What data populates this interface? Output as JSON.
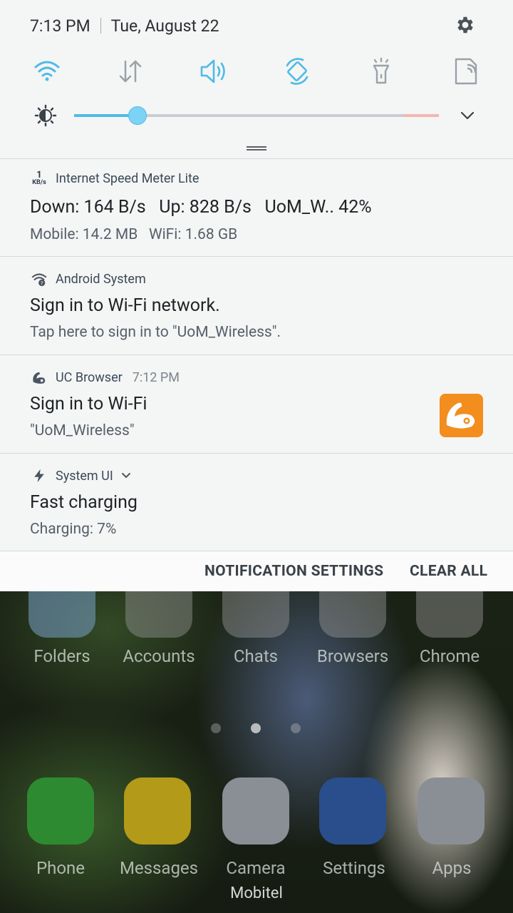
{
  "status_bar": {
    "time": "7:13 PM",
    "date": "Tue, August 22"
  },
  "quick_settings": {
    "toggles": [
      {
        "name": "wifi-icon",
        "active": true
      },
      {
        "name": "data-transfer-icon",
        "active": false
      },
      {
        "name": "sound-icon",
        "active": true
      },
      {
        "name": "auto-rotate-icon",
        "active": true
      },
      {
        "name": "flashlight-icon",
        "active": false
      },
      {
        "name": "screen-mirror-icon",
        "active": false
      }
    ],
    "brightness_level": 0.17,
    "accent_color": "#4fbbe6"
  },
  "notifications": [
    {
      "app": "Internet Speed Meter Lite",
      "icon_text_top": "1",
      "icon_text_bottom": "KB/s",
      "title": "Down: 164 B/s   Up: 828 B/s   UoM_W.. 42%",
      "text": "Mobile: 14.2 MB   WiFi: 1.68 GB"
    },
    {
      "app": "Android System",
      "title": "Sign in to Wi-Fi network.",
      "text": "Tap here to sign in to \"UoM_Wireless\"."
    },
    {
      "app": "UC Browser",
      "time": "7:12 PM",
      "title": "Sign in to Wi-Fi",
      "text": "\"UoM_Wireless\""
    },
    {
      "app": "System UI",
      "title": "Fast charging",
      "text": "Charging: 7%"
    }
  ],
  "actions": {
    "settings_label": "NOTIFICATION SETTINGS",
    "clear_label": "CLEAR ALL"
  },
  "home": {
    "top_row": [
      "Folders",
      "Accounts",
      "Chats",
      "Browsers",
      "Chrome"
    ],
    "dock": [
      "Phone",
      "Messages",
      "Camera",
      "Settings",
      "Apps"
    ],
    "carrier": "Mobitel"
  }
}
